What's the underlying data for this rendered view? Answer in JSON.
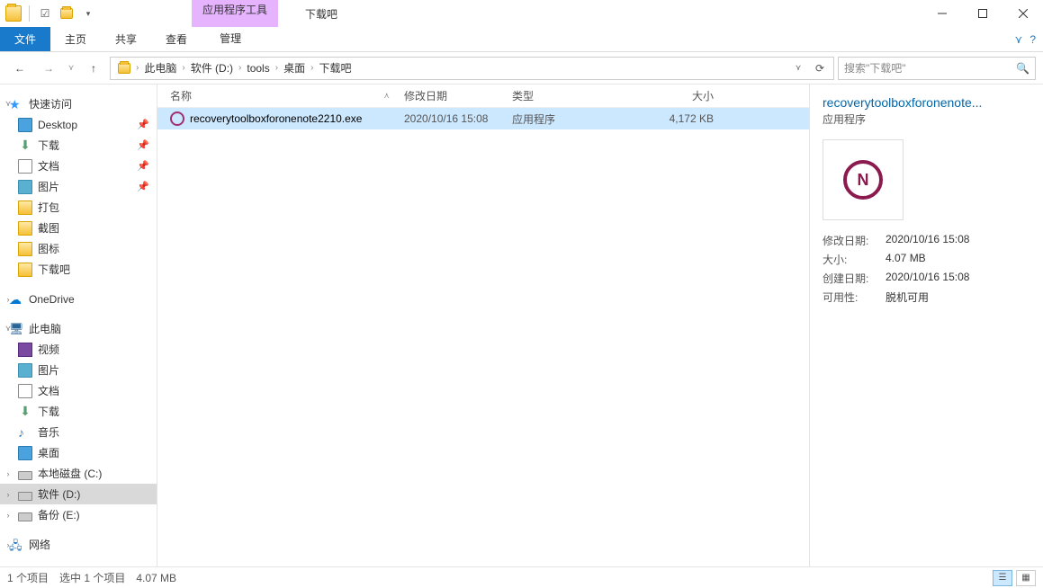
{
  "title": {
    "context_tab": "应用程序工具",
    "window": "下载吧"
  },
  "ribbon": {
    "file": "文件",
    "tabs": [
      "主页",
      "共享",
      "查看"
    ],
    "ctx_tab": "管理"
  },
  "breadcrumb": [
    "此电脑",
    "软件 (D:)",
    "tools",
    "桌面",
    "下载吧"
  ],
  "search": {
    "placeholder": "搜索\"下载吧\""
  },
  "sidebar": {
    "quick": {
      "label": "快速访问",
      "items": [
        {
          "label": "Desktop",
          "pinned": true,
          "icon": "desktop"
        },
        {
          "label": "下载",
          "pinned": true,
          "icon": "download"
        },
        {
          "label": "文档",
          "pinned": true,
          "icon": "doc"
        },
        {
          "label": "图片",
          "pinned": true,
          "icon": "pic"
        },
        {
          "label": "打包",
          "icon": "folder"
        },
        {
          "label": "截图",
          "icon": "folder"
        },
        {
          "label": "图标",
          "icon": "folder"
        },
        {
          "label": "下载吧",
          "icon": "folder"
        }
      ]
    },
    "onedrive": "OneDrive",
    "thispc": {
      "label": "此电脑",
      "items": [
        {
          "label": "视频",
          "icon": "video"
        },
        {
          "label": "图片",
          "icon": "pic"
        },
        {
          "label": "文档",
          "icon": "doc"
        },
        {
          "label": "下载",
          "icon": "download"
        },
        {
          "label": "音乐",
          "icon": "music"
        },
        {
          "label": "桌面",
          "icon": "desktop"
        },
        {
          "label": "本地磁盘 (C:)",
          "icon": "drive"
        },
        {
          "label": "软件 (D:)",
          "icon": "drive",
          "selected": true
        },
        {
          "label": "备份 (E:)",
          "icon": "drive"
        }
      ]
    },
    "network": "网络"
  },
  "columns": {
    "name": "名称",
    "date": "修改日期",
    "type": "类型",
    "size": "大小"
  },
  "files": [
    {
      "name": "recoverytoolboxforonenote2210.exe",
      "date": "2020/10/16 15:08",
      "type": "应用程序",
      "size": "4,172 KB",
      "selected": true
    }
  ],
  "details": {
    "name": "recoverytoolboxforonenote...",
    "type": "应用程序",
    "meta": [
      {
        "k": "修改日期:",
        "v": "2020/10/16 15:08"
      },
      {
        "k": "大小:",
        "v": "4.07 MB"
      },
      {
        "k": "创建日期:",
        "v": "2020/10/16 15:08"
      },
      {
        "k": "可用性:",
        "v": "脱机可用"
      }
    ]
  },
  "status": {
    "count": "1 个项目",
    "selected": "选中 1 个项目",
    "size": "4.07 MB"
  }
}
